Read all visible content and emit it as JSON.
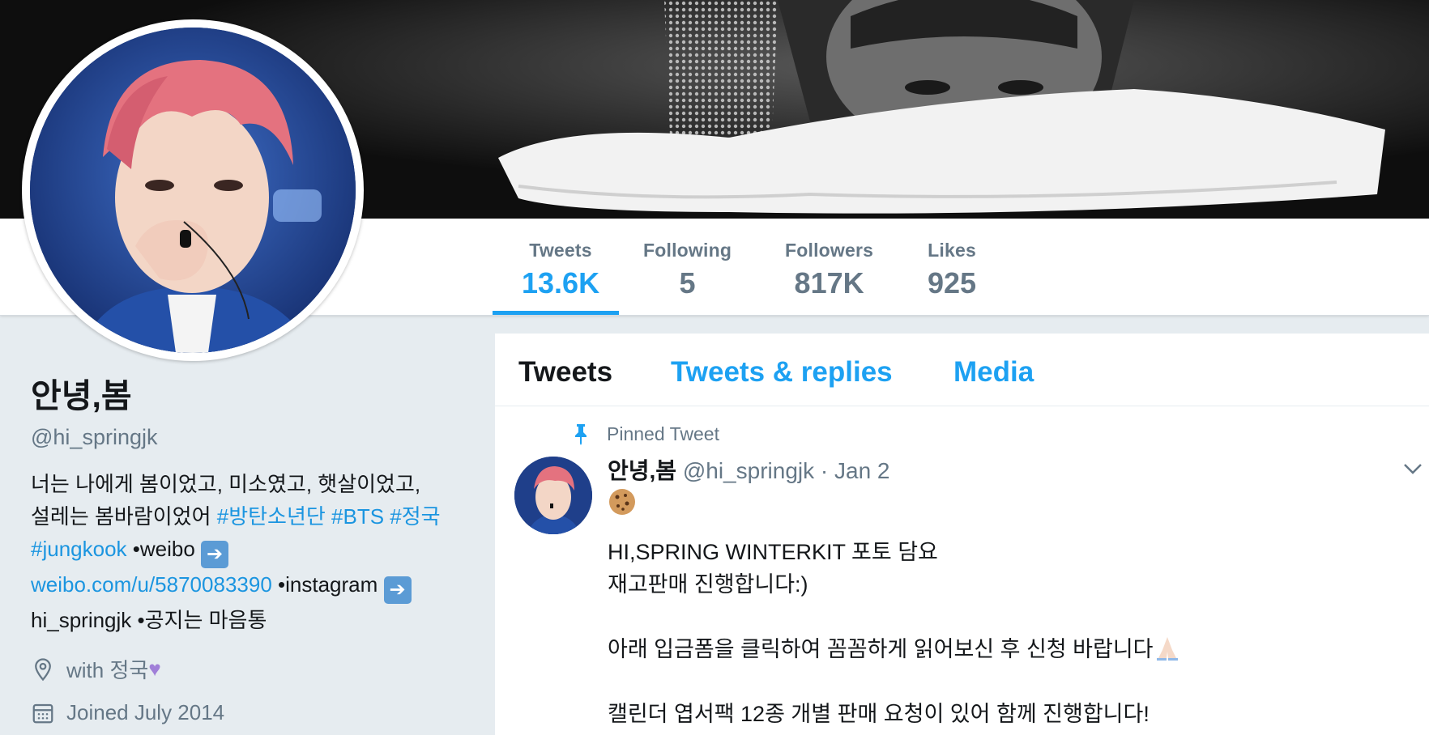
{
  "profile": {
    "name": "안녕,봄",
    "handle": "@hi_springjk",
    "bio_line1": "너는 나에게 봄이었고, 미소였고, 햇살이었고,",
    "bio_line2_text": "설레는 봄바람이었어 ",
    "hashtag1": "#방탄소년단",
    "hashtag2": "#BTS",
    "hashtag3": "#정국",
    "hashtag4": "#jungkook",
    "weibo_label": " •weibo ",
    "weibo_link": "weibo.com/u/5870083390",
    "instagram_label": " •instagram ",
    "instagram_handle": "hi_springjk",
    "notice": " •공지는 마음통",
    "location": "with 정국",
    "joined": "Joined July 2014"
  },
  "stats": [
    {
      "label": "Tweets",
      "value": "13.6K",
      "active": true
    },
    {
      "label": "Following",
      "value": "5"
    },
    {
      "label": "Followers",
      "value": "817K"
    },
    {
      "label": "Likes",
      "value": "925"
    }
  ],
  "tabs": [
    {
      "label": "Tweets",
      "active": true
    },
    {
      "label": "Tweets & replies"
    },
    {
      "label": "Media"
    }
  ],
  "tweet": {
    "pinned_label": "Pinned Tweet",
    "author_name": "안녕,봄",
    "author_handle": "@hi_springjk",
    "date": "· Jan 2",
    "line1": "HI,SPRING WINTERKIT 포토 담요",
    "line2": "재고판매 진행합니다:)",
    "line3": "아래 입금폼을 클릭하여 꼼꼼하게 읽어보신 후 신청 바랍니다",
    "line4": "캘린더 엽서팩 12종 개별 판매 요청이 있어 함께 진행합니다!"
  },
  "icons": {
    "location": "location-pin-icon",
    "calendar": "calendar-icon",
    "pin": "pin-icon",
    "caret": "chevron-down-icon",
    "arrow": "right-arrow-emoji",
    "heart": "purple-heart-emoji",
    "cookie": "cookie-emoji",
    "pray": "folded-hands-emoji"
  },
  "colors": {
    "accent": "#1da1f2",
    "link": "#1b95e0",
    "secondary_text": "#657786",
    "page_bg": "#e6ecf0"
  }
}
